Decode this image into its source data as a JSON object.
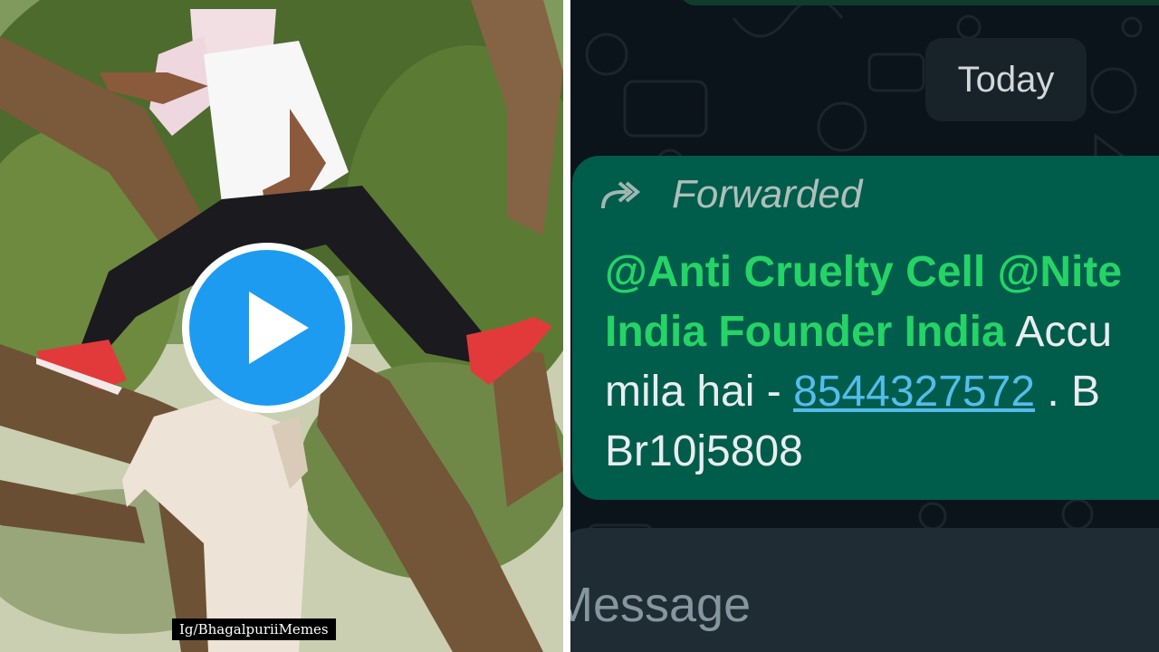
{
  "left_panel": {
    "watermark": "Ig/BhagalpuriiMemes",
    "play_icon": "play-icon"
  },
  "chat": {
    "date_label": "Today",
    "forwarded_label": "Forwarded",
    "forward_icon": "forward-arrows-icon",
    "message": {
      "mention_1": "@Anti Cruelty Cell",
      "mention_2": "@Nite",
      "mention_3": "India Founder India",
      "text_1": " Accu",
      "text_2": "mila hai - ",
      "phone": "8544327572",
      "text_3": " . B",
      "text_4": "Br10j5808"
    },
    "input_placeholder": "Message"
  },
  "colors": {
    "chat_bg": "#0b141a",
    "bubble": "#005c4b",
    "mention": "#25d366",
    "link": "#53bdeb",
    "play_button": "#1d9bf0"
  }
}
